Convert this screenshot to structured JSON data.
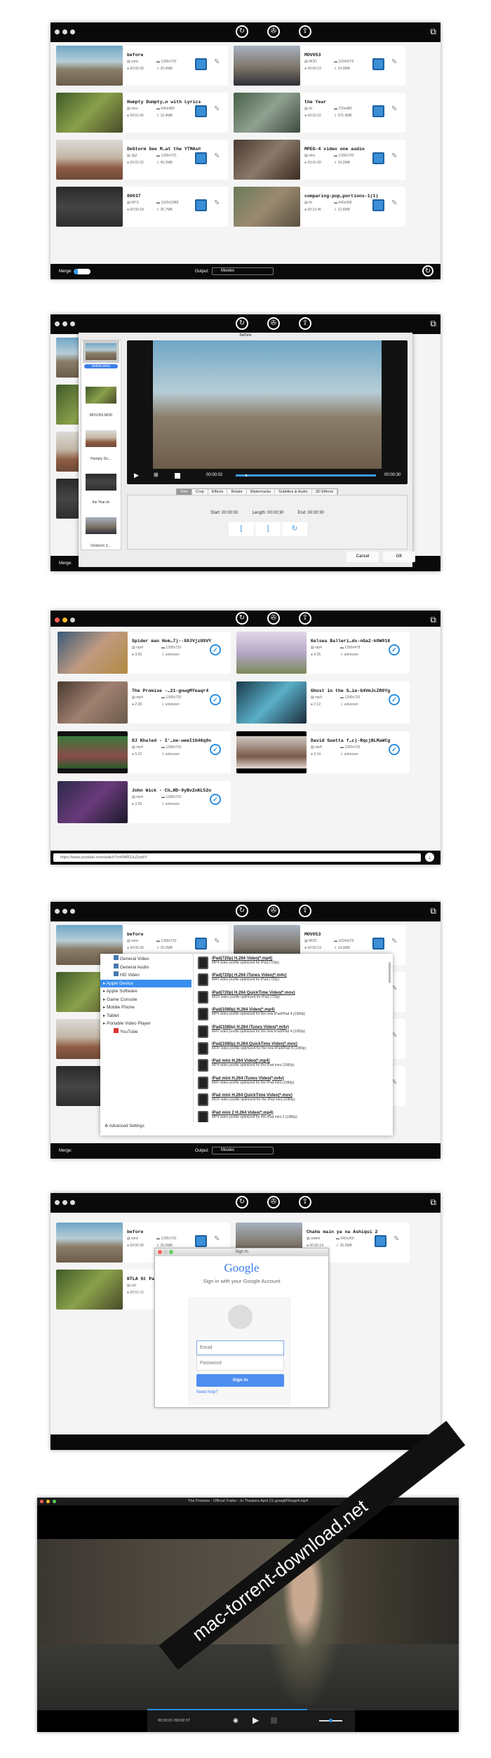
{
  "toolbar": {
    "icons": [
      "convert-icon",
      "download-icon",
      "share-icon",
      "toolbox-icon"
    ]
  },
  "shot1": {
    "merge_label": "Merge:",
    "output_label": "Output:",
    "output_value": "Movies",
    "items": [
      {
        "title": "before",
        "format": "wmv",
        "resolution": "1280x720",
        "duration": "00:00:30",
        "size": "25.0MB",
        "thumb": "hor"
      },
      {
        "title": "MOV053",
        "format": "MOD",
        "resolution": "1024x576",
        "duration": "00:00:19",
        "size": "14.3MB",
        "thumb": "city"
      },
      {
        "title": "Humpty Dumpty…n with Lyrics",
        "format": "mov",
        "resolution": "640x480",
        "duration": "00:01:06",
        "size": "12.4MB",
        "thumb": "hob"
      },
      {
        "title": "the Year",
        "format": "dv",
        "resolution": "720x480",
        "duration": "00:02:22",
        "size": "975.3MB",
        "thumb": "dino"
      },
      {
        "title": "DeStorm See M…at the YTMAs®",
        "format": "3g2",
        "resolution": "1280x720",
        "duration": "00:02:22",
        "size": "45.3MB",
        "thumb": "des"
      },
      {
        "title": "MPEG-4 video one audio",
        "format": "mkv",
        "resolution": "1280x720",
        "duration": "00:01:00",
        "size": "19.2MB",
        "thumb": "kit"
      },
      {
        "title": "00037",
        "format": "MTS",
        "resolution": "1920x1088",
        "duration": "00:00:18",
        "size": "35.7MB",
        "thumb": "grp"
      },
      {
        "title": "comparing-pop…portions-1(1)",
        "format": "flv",
        "resolution": "640x368",
        "duration": "00:10:46",
        "size": "12.6MB",
        "thumb": "raptor"
      }
    ]
  },
  "shot2": {
    "dialog_title": "before",
    "files": [
      "before.wmv",
      "MOV053.MOD",
      "Humpty Du…",
      "the Year.dv",
      "DeStorm S…"
    ],
    "current_time": "00:00:02",
    "total_time": "00:00:30",
    "progress": 0.07,
    "tabs": [
      "Trim",
      "Crop",
      "Effects",
      "Rotate",
      "Watermarks",
      "Subtitles & Audio",
      "3D Effects"
    ],
    "start": "Start: 00:00:00",
    "length": "Length: 00:00:30",
    "end": "End: 00:00:30",
    "mark_in": "[",
    "mark_out": "]",
    "reset": "↻",
    "cancel": "Cancel",
    "ok": "OK",
    "merge_label": "Merge:"
  },
  "shot3": {
    "url": "https://www.youtube.com/watch?v=6WR3JuZywbY",
    "items": [
      {
        "title": "Spider man Hom…7)--X0JVjzUSVY",
        "format": "mp4",
        "resolution": "1280x720",
        "duration": "3:00",
        "size": "unknown",
        "thumb": "y1"
      },
      {
        "title": "Kelsea Balleri…ds-nGa2-kOW018",
        "format": "mp4",
        "resolution": "1280x478",
        "duration": "4:25",
        "size": "unknown",
        "thumb": "y2"
      },
      {
        "title": "The Promise -…21-gnwgMYeaqr4",
        "format": "mp4",
        "resolution": "1280x720",
        "duration": "2:38",
        "size": "unknown",
        "thumb": "y3"
      },
      {
        "title": "Ghost in the S…ie-G4VmJcZR0Yg",
        "format": "mp4",
        "resolution": "1280x720",
        "duration": "2:12",
        "size": "unknown",
        "thumb": "y4"
      },
      {
        "title": "DJ Khaled - I'…ne-weeI1G46q0o",
        "format": "mp4",
        "resolution": "1280x720",
        "duration": "5:22",
        "size": "unknown",
        "thumb": "y5"
      },
      {
        "title": "David Guetta f…c)-RqcjBLMaWCg",
        "format": "mp4",
        "resolution": "1280x720",
        "duration": "3:14",
        "size": "unknown",
        "thumb": "y6"
      },
      {
        "title": "John Wick - Ch…HD-0yBvZnKL52o",
        "format": "mp4",
        "resolution": "1280x720",
        "duration": "3:39",
        "size": "unknown",
        "thumb": "y7"
      }
    ]
  },
  "shot4": {
    "categories": [
      {
        "label": "General Video",
        "type": "leaf",
        "icon": "film-icon"
      },
      {
        "label": "General Audio",
        "type": "leaf",
        "icon": "music-icon"
      },
      {
        "label": "HD Video",
        "type": "leaf",
        "icon": "hd-icon"
      },
      {
        "label": "Apple Device",
        "type": "group",
        "selected": true
      },
      {
        "label": "Apple Software",
        "type": "group"
      },
      {
        "label": "Game Console",
        "type": "group"
      },
      {
        "label": "Mobile Phone",
        "type": "group"
      },
      {
        "label": "Tablet",
        "type": "group"
      },
      {
        "label": "Portable Video Player",
        "type": "group"
      },
      {
        "label": "YouTube",
        "type": "leaf",
        "icon": "youtube-icon"
      }
    ],
    "advanced": "Advanced Settings",
    "profiles": [
      {
        "name": "iPad(720p) H.264 Video(*.mp4)",
        "desc": "MP4 video profile optimized for iPad.(720p)"
      },
      {
        "name": "iPad(720p) H.264 iTunes Video(*.m4v)",
        "desc": "M4V video profile optimized for iPad.(720p)"
      },
      {
        "name": "iPad(720p) H.264 QuickTime Video(*.mov)",
        "desc": "MOV video profile optimized for iPad.(720p)"
      },
      {
        "name": "iPad(1080p) H.264 Video(*.mp4)",
        "desc": "MP4 video profile optimized for the new iPad/iPad 4.(1080p)"
      },
      {
        "name": "iPad(1080p) H.264 iTunes Video(*.m4v)",
        "desc": "M4V video profile optimized for the new iPad/iPad 4.(1080p)"
      },
      {
        "name": "iPad(1080p) H.264 QuickTime Video(*.mov)",
        "desc": "MOV video profile optimized for the new iPad/iPad 4.(1080p)"
      },
      {
        "name": "iPad mini H.264 Video(*.mp4)",
        "desc": "MP4 video profile optimized for the iPad mini.(1080p)"
      },
      {
        "name": "iPad mini H.264 iTunes Video(*.m4v)",
        "desc": "M4V video profile optimized for the iPad mini.(1080p)"
      },
      {
        "name": "iPad mini H.264 QuickTime Video(*.mov)",
        "desc": "MOV video profile optimized for the iPad mini.(1080p)"
      },
      {
        "name": "iPad mini 2 H.264 Video(*.mp4)",
        "desc": "MP4 video profile optimized for the iPad mini 2.(1080p)"
      }
    ]
  },
  "shot5": {
    "items": [
      {
        "title": "before",
        "format": "wmv",
        "resolution": "1280x720",
        "duration": "00:00:30",
        "size": "25.0MB",
        "thumb": "hor"
      },
      {
        "title": "Chahu main ya na Ashiqui 2",
        "format": "webm",
        "resolution": "540x360",
        "duration": "00:05:14",
        "size": "26.3MB",
        "thumb": "city"
      },
      {
        "title": "KTLA St Pa",
        "format": "asf",
        "resolution": "",
        "duration": "00:01:15",
        "size": "",
        "thumb": "hob"
      }
    ],
    "dialog_title": "Sign In",
    "logo": "Google",
    "heading": "Sign in with your Google Account",
    "email_placeholder": "Email",
    "password_placeholder": "Password",
    "sign_in": "Sign in",
    "help": "Need help?"
  },
  "shot6": {
    "title": "The Promise - Official Trailer - In Theaters April 21-gnwgMYeaqr4.mp4",
    "time": "00:02:01 /00:02:37",
    "progress": 0.77,
    "volume": 0.5,
    "watermark": "mac-torrent-download.net"
  }
}
